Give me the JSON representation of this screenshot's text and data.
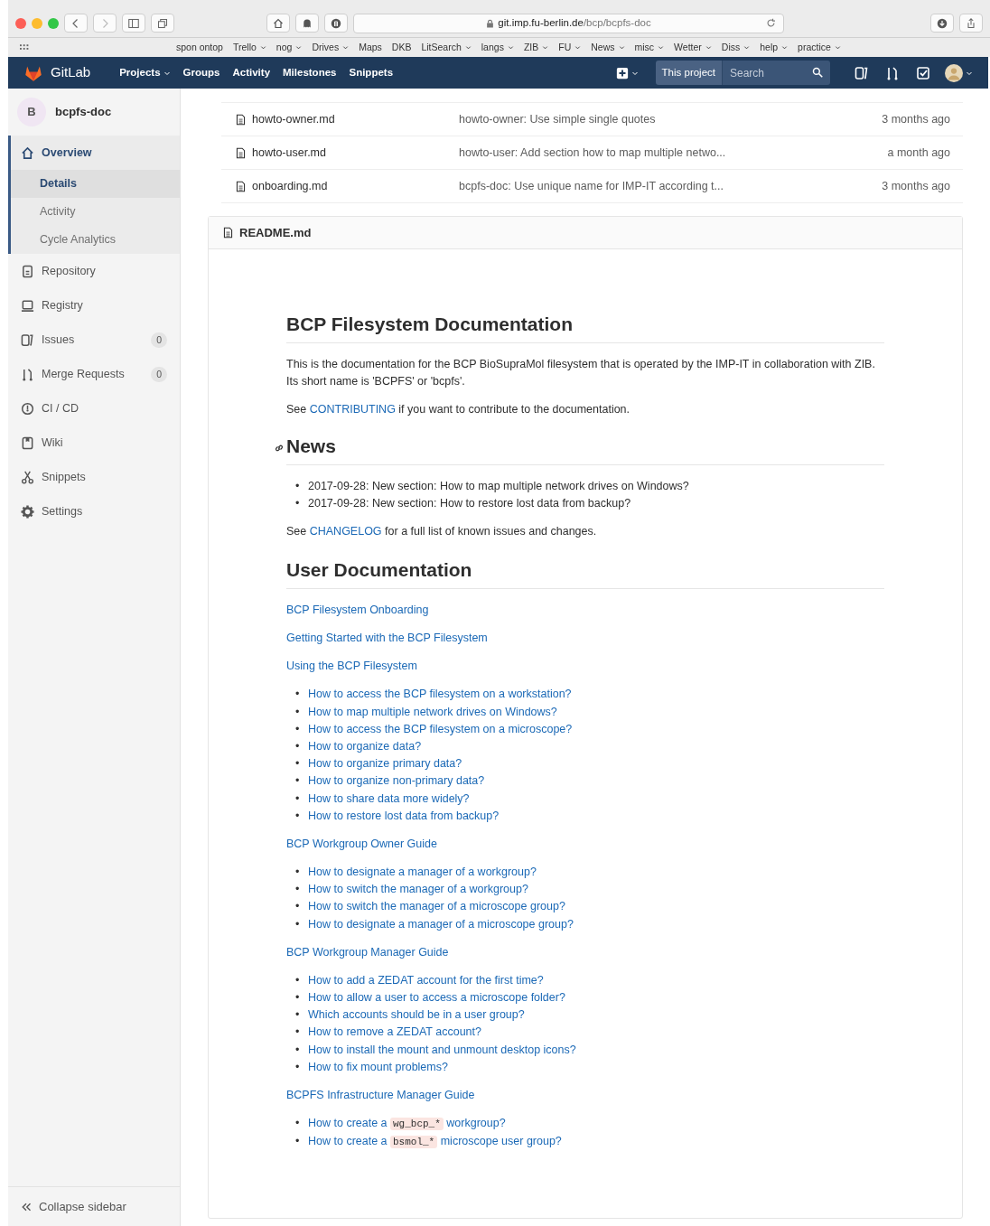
{
  "browser": {
    "url_host": "git.imp.fu-berlin.de",
    "url_path": "/bcp/bcpfs-doc",
    "bookmarks": [
      {
        "label": "spon ontop",
        "folder": false
      },
      {
        "label": "Trello",
        "folder": true
      },
      {
        "label": "nog",
        "folder": true
      },
      {
        "label": "Drives",
        "folder": true
      },
      {
        "label": "Maps",
        "folder": false
      },
      {
        "label": "DKB",
        "folder": false
      },
      {
        "label": "LitSearch",
        "folder": true
      },
      {
        "label": "langs",
        "folder": true
      },
      {
        "label": "ZIB",
        "folder": true
      },
      {
        "label": "FU",
        "folder": true
      },
      {
        "label": "News",
        "folder": true
      },
      {
        "label": "misc",
        "folder": true
      },
      {
        "label": "Wetter",
        "folder": true
      },
      {
        "label": "Diss",
        "folder": true
      },
      {
        "label": "help",
        "folder": true
      },
      {
        "label": "practice",
        "folder": true
      }
    ]
  },
  "navbar": {
    "brand": "GitLab",
    "links": [
      {
        "label": "Projects",
        "dropdown": true
      },
      {
        "label": "Groups",
        "dropdown": false
      },
      {
        "label": "Activity",
        "dropdown": false
      },
      {
        "label": "Milestones",
        "dropdown": false
      },
      {
        "label": "Snippets",
        "dropdown": false
      }
    ],
    "scope": "This project",
    "search_placeholder": "Search"
  },
  "sidebar": {
    "project_initial": "B",
    "project_name": "bcpfs-doc",
    "items": [
      {
        "label": "Overview",
        "selected": true,
        "children": [
          {
            "label": "Details",
            "selected": true
          },
          {
            "label": "Activity",
            "selected": false
          },
          {
            "label": "Cycle Analytics",
            "selected": false
          }
        ]
      },
      {
        "label": "Repository",
        "selected": false
      },
      {
        "label": "Registry",
        "selected": false
      },
      {
        "label": "Issues",
        "selected": false,
        "count": "0"
      },
      {
        "label": "Merge Requests",
        "selected": false,
        "count": "0"
      },
      {
        "label": "CI / CD",
        "selected": false
      },
      {
        "label": "Wiki",
        "selected": false
      },
      {
        "label": "Snippets",
        "selected": false
      },
      {
        "label": "Settings",
        "selected": false
      }
    ],
    "collapse": "Collapse sidebar"
  },
  "files": [
    {
      "name": "howto-owner.md",
      "commit": "howto-owner: Use simple single quotes",
      "time": "3 months ago"
    },
    {
      "name": "howto-user.md",
      "commit": "howto-user: Add section how to map multiple netwo...",
      "time": "a month ago"
    },
    {
      "name": "onboarding.md",
      "commit": "bcpfs-doc: Use unique name for IMP-IT according t...",
      "time": "3 months ago"
    }
  ],
  "readme": {
    "filename": "README.md",
    "title": "BCP Filesystem Documentation",
    "intro": "This is the documentation for the BCP BioSupraMol filesystem that is operated by the IMP-IT in collaboration with ZIB. Its short name is 'BCPFS' or 'bcpfs'.",
    "contributing": {
      "before": "See ",
      "link": "CONTRIBUTING",
      "after": " if you want to contribute to the documentation."
    },
    "news_title": "News",
    "news": [
      {
        "marker": "•",
        "text": "2017-09-28: New section: How to map multiple network drives on Windows?"
      },
      {
        "marker": "•",
        "text": "2017-09-28: New section: How to restore lost data from backup?"
      }
    ],
    "changelog": {
      "before": "See ",
      "link": "CHANGELOG",
      "after": " for a full list of known issues and changes."
    },
    "user_doc_title": "User Documentation",
    "sections": [
      {
        "title": "BCP Filesystem Onboarding"
      },
      {
        "title": "Getting Started with the BCP Filesystem"
      },
      {
        "title": "Using the BCP Filesystem",
        "items": [
          {
            "marker": "•",
            "text": "How to access the BCP filesystem on a workstation?"
          },
          {
            "marker": "•",
            "text": "How to map multiple network drives on Windows?"
          },
          {
            "marker": "•",
            "text": "How to access the BCP filesystem on a microscope?"
          },
          {
            "marker": "•",
            "text": "How to organize data?"
          },
          {
            "marker": "•",
            "text": "How to organize primary data?"
          },
          {
            "marker": "•",
            "text": "How to organize non-primary data?"
          },
          {
            "marker": "•",
            "text": "How to share data more widely?"
          },
          {
            "marker": "•",
            "text": "How to restore lost data from backup?"
          }
        ]
      },
      {
        "title": "BCP Workgroup Owner Guide",
        "items": [
          {
            "marker": "•",
            "text": "How to designate a manager of a workgroup?"
          },
          {
            "marker": "•",
            "text": "How to switch the manager of a workgroup?"
          },
          {
            "marker": "•",
            "text": "How to switch the manager of a microscope group?"
          },
          {
            "marker": "•",
            "text": "How to designate a manager of a microscope group?"
          }
        ]
      },
      {
        "title": "BCP Workgroup Manager Guide",
        "items": [
          {
            "marker": "•",
            "text": "How to add a ZEDAT account for the first time?"
          },
          {
            "marker": "•",
            "text": "How to allow a user to access a microscope folder?"
          },
          {
            "marker": "•",
            "text": "Which accounts should be in a user group?"
          },
          {
            "marker": "•",
            "text": "How to remove a ZEDAT account?"
          },
          {
            "marker": "•",
            "text": "How to install the mount and unmount desktop icons?"
          },
          {
            "marker": "•",
            "text": "How to fix mount problems?"
          }
        ]
      },
      {
        "title": "BCPFS Infrastructure Manager Guide",
        "items": [
          {
            "marker": "•",
            "text": "How to create a ",
            "code": "wg_bcp_*",
            "after": " workgroup?"
          },
          {
            "marker": "•",
            "text": "How to create a ",
            "code": "bsmol_*",
            "after": " microscope user group?"
          }
        ]
      }
    ]
  }
}
